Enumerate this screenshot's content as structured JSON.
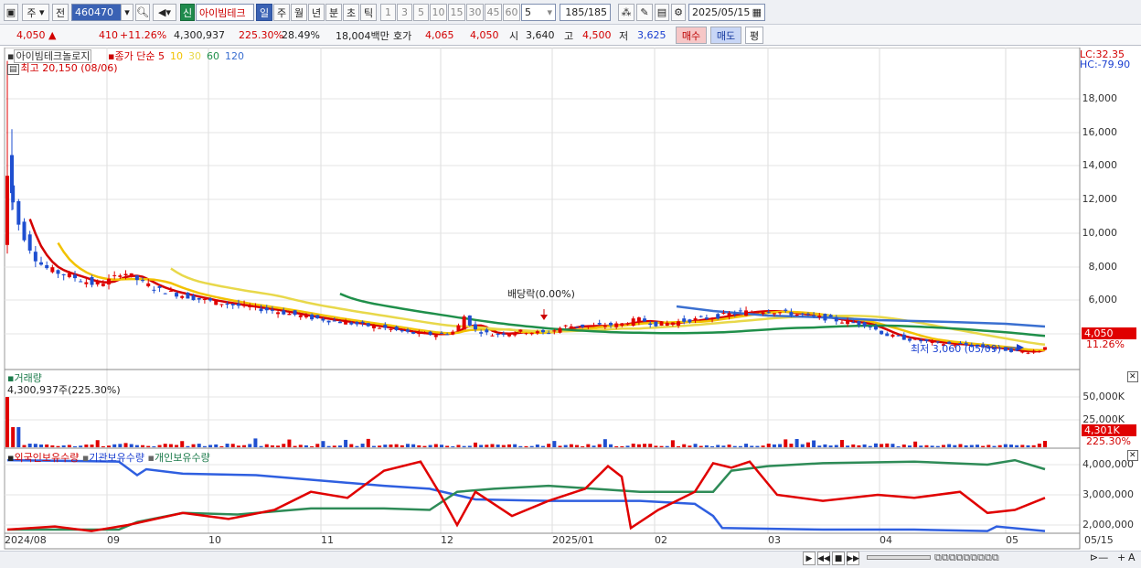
{
  "toolbar": {
    "market": "주",
    "prev": "전",
    "code": "460470",
    "new_badge": "신",
    "stock_name": "아이빔테크",
    "periods": [
      "일",
      "주",
      "월",
      "년",
      "분",
      "초",
      "틱"
    ],
    "active_period": "일",
    "intervals": [
      "1",
      "3",
      "5",
      "10",
      "15",
      "30",
      "45",
      "60"
    ],
    "count_value": "5",
    "range": "185/185",
    "date": "2025/05/15"
  },
  "quote": {
    "price": "4,050",
    "arrow": "▲",
    "change": "410",
    "change_pct": "+11.26%",
    "volume": "4,300,937",
    "vol_ratio": "225.30%",
    "turnover_pct": "28.49%",
    "amount": "18,004백만",
    "bid_label": "호가",
    "bid": "4,065",
    "ask": "4,050",
    "open_label": "시",
    "open": "3,640",
    "high_label": "고",
    "high": "4,500",
    "low_label": "저",
    "low": "3,625",
    "buy_label": "매수",
    "sell_label": "매도",
    "avg_label": "평"
  },
  "price_panel": {
    "title": "아이빔테크놀로지",
    "ma_label": "종가 단순",
    "ma_periods": [
      "5",
      "10",
      "30",
      "60",
      "120"
    ],
    "ma_colors": [
      "#d40000",
      "#f2c200",
      "#e8d84a",
      "#1f8f4a",
      "#3a6fd0"
    ],
    "high_note": "최고 20,150 (08/06)",
    "low_note": "최저 3,060 (05/09)",
    "dividend_note": "배당락(0.00%)",
    "lc": "LC:32.35",
    "hc": "HC:-79.90",
    "y_ticks": [
      "18,000",
      "16,000",
      "14,000",
      "12,000",
      "10,000",
      "8,000",
      "6,000"
    ],
    "current_tag": "4,050",
    "current_pct": "11.26%"
  },
  "volume_panel": {
    "title": "거래량",
    "note": "4,300,937주(225.30%)",
    "y_ticks": [
      "50,000K",
      "25,000K"
    ],
    "current_tag": "4,301K",
    "current_pct": "225.30%"
  },
  "holding_panel": {
    "labels": [
      "외국인보유수량",
      "기관보유수량",
      "개인보유수량"
    ],
    "y_ticks": [
      "4,000,000",
      "3,000,000",
      "2,000,000"
    ]
  },
  "x_axis": [
    "2024/08",
    "09",
    "10",
    "11",
    "12",
    "2025/01",
    "02",
    "03",
    "04",
    "05",
    "05/15"
  ],
  "chart_data": {
    "type": "candlestick",
    "panels": [
      "price",
      "volume",
      "holdings"
    ],
    "price_axis_ticks": [
      6000,
      8000,
      10000,
      12000,
      14000,
      16000,
      18000
    ],
    "price_high": {
      "value": 20150,
      "date": "08/06"
    },
    "price_low": {
      "value": 3060,
      "date": "05/09"
    },
    "last_close": 4050,
    "last_change_pct": 11.26,
    "last_volume": 4300937,
    "moving_averages": [
      5,
      10,
      30,
      60,
      120
    ],
    "months": [
      "2024/08",
      "09",
      "10",
      "11",
      "12",
      "2025/01",
      "02",
      "03",
      "04",
      "05"
    ]
  }
}
